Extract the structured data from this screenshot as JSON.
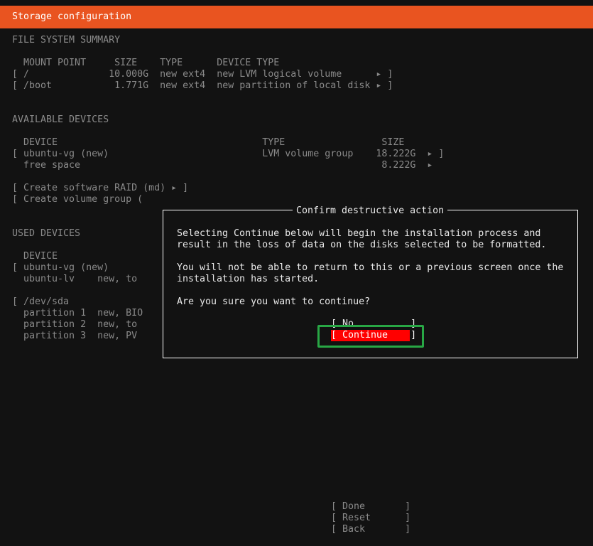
{
  "window": {
    "title": "Storage configuration"
  },
  "fs_summary": {
    "heading": "FILE SYSTEM SUMMARY",
    "header": "  MOUNT POINT     SIZE    TYPE      DEVICE TYPE",
    "rows": [
      "[ /              10.000G  new ext4  new LVM logical volume      ▸ ]",
      "[ /boot           1.771G  new ext4  new partition of local disk ▸ ]"
    ]
  },
  "available": {
    "heading": "AVAILABLE DEVICES",
    "header": "  DEVICE                                    TYPE                 SIZE",
    "rows": [
      "[ ubuntu-vg (new)                           LVM volume group    18.222G  ▸ ]",
      "  free space                                                     8.222G  ▸"
    ],
    "actions": [
      "[ Create software RAID (md) ▸ ]",
      "[ Create volume group ("
    ]
  },
  "used": {
    "heading": "USED DEVICES",
    "header": "  DEVICE",
    "rows": [
      "[ ubuntu-vg (new)",
      "  ubuntu-lv    new, to",
      "",
      "[ /dev/sda",
      "  partition 1  new, BIO",
      "  partition 2  new, to",
      "  partition 3  new, PV"
    ]
  },
  "dialog": {
    "title": "Confirm destructive action",
    "lines": [
      "Selecting Continue below will begin the installation process and",
      "result in the loss of data on the disks selected to be formatted.",
      "",
      "You will not be able to return to this or a previous screen once the",
      "installation has started.",
      "",
      "Are you sure you want to continue?"
    ],
    "no_label": "[ No          ]",
    "continue_label": "[ Continue    ]"
  },
  "bottom_buttons": {
    "done": "[ Done       ]",
    "reset": "[ Reset      ]",
    "back": "[ Back       ]"
  },
  "colors": {
    "title_bar": "#e95420",
    "selected_button": "#ff0000",
    "highlight_box": "#28a745",
    "background": "#121212"
  }
}
